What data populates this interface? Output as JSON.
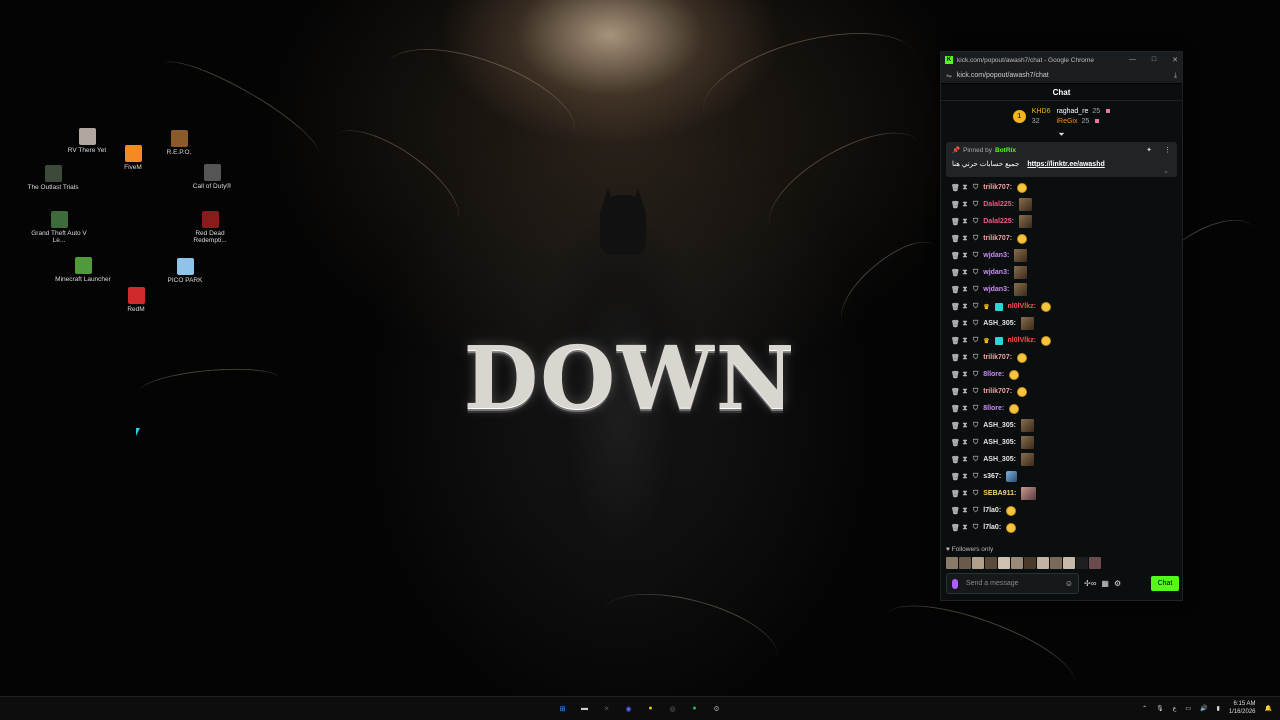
{
  "wallpaper": {
    "title": "DOWN"
  },
  "desktop": {
    "icons": [
      {
        "label": "RV There Yet",
        "icon": "rv-game-icon",
        "color": "#b0a7a0"
      },
      {
        "label": "R.E.P.O.",
        "icon": "repo-game-icon",
        "color": "#8a5a2b"
      },
      {
        "label": "The Outlast Trials",
        "icon": "outlast-icon",
        "color": "#3c4a3a"
      },
      {
        "label": "FiveM",
        "icon": "fivem-icon",
        "color": "#f28b22"
      },
      {
        "label": "Call of Duty®",
        "icon": "cod-icon",
        "color": "#555555"
      },
      {
        "label": "Grand Theft Auto V Le...",
        "icon": "gta-icon",
        "color": "#3e6b3a"
      },
      {
        "label": "Red Dead Redempti...",
        "icon": "rdr-icon",
        "color": "#8b1a1a"
      },
      {
        "label": "Minecraft Launcher",
        "icon": "minecraft-icon",
        "color": "#4f9a3a"
      },
      {
        "label": "PICO PARK",
        "icon": "picopark-icon",
        "color": "#8fc4e8"
      },
      {
        "label": "RedM",
        "icon": "redm-icon",
        "color": "#d02a2a"
      }
    ]
  },
  "browser": {
    "title": "kick.com/popout/awash7/chat - Google Chrome",
    "url": "kick.com/popout/awash7/chat",
    "controls": {
      "minimize": "—",
      "maximize": "□",
      "close": "✕"
    }
  },
  "chat": {
    "header": "Chat",
    "leaderboard": {
      "rank": "1",
      "entries": [
        {
          "name": "KHD6",
          "count": "32",
          "color": "#f2b617"
        },
        {
          "name": "raghad_re",
          "count": "25",
          "color": "#ffffff"
        },
        {
          "name": "iReGix",
          "count": "25",
          "color": "#f08a1f"
        }
      ]
    },
    "pinned": {
      "prefix": "Pinned by",
      "pinned_by": "BotRix",
      "text": "جميع حسابات حرتي هنا",
      "link": "https://linktr.ee/awashd"
    },
    "messages": [
      {
        "user": "trilik707:",
        "color": "#f2a1a1",
        "emote": "round"
      },
      {
        "user": "Dalal225:",
        "color": "#f05a8a",
        "emote": "pic"
      },
      {
        "user": "Dalal225:",
        "color": "#f05a8a",
        "emote": "pic"
      },
      {
        "user": "trilik707:",
        "color": "#f2a1a1",
        "emote": "round"
      },
      {
        "user": "wjdan3:",
        "color": "#c78cf2",
        "emote": "pic"
      },
      {
        "user": "wjdan3:",
        "color": "#c78cf2",
        "emote": "pic"
      },
      {
        "user": "wjdan3:",
        "color": "#c78cf2",
        "emote": "pic"
      },
      {
        "user": "nl0lVlkz:",
        "color": "#ff4b4b",
        "emote": "round",
        "badges": "crown-vip"
      },
      {
        "user": "ASH_305:",
        "color": "#e8e8e8",
        "emote": "pic"
      },
      {
        "user": "nl0lVlkz:",
        "color": "#ff4b4b",
        "emote": "round",
        "badges": "crown-vip"
      },
      {
        "user": "trilik707:",
        "color": "#f2a1a1",
        "emote": "round"
      },
      {
        "user": "8llore:",
        "color": "#c78cf2",
        "emote": "round"
      },
      {
        "user": "trilik707:",
        "color": "#f2a1a1",
        "emote": "round"
      },
      {
        "user": "8llore:",
        "color": "#c78cf2",
        "emote": "round"
      },
      {
        "user": "ASH_305:",
        "color": "#e8e8e8",
        "emote": "pic"
      },
      {
        "user": "ASH_305:",
        "color": "#e8e8e8",
        "emote": "pic"
      },
      {
        "user": "ASH_305:",
        "color": "#e8e8e8",
        "emote": "pic"
      },
      {
        "user": "s367:",
        "color": "#e8e8e8",
        "emote": "blue"
      },
      {
        "user": "SEBA911:",
        "color": "#f2d36b",
        "emote": "pic2"
      },
      {
        "user": "l7la0:",
        "color": "#e8e8e8",
        "emote": "round"
      },
      {
        "user": "l7la0:",
        "color": "#e8e8e8",
        "emote": "round"
      }
    ],
    "followers_only": "Followers only",
    "input_placeholder": "Send a message",
    "send_label": "Chat"
  },
  "taskbar": {
    "apps": [
      {
        "name": "start",
        "glyph": "⊞",
        "color": "#3aa0ff"
      },
      {
        "name": "file-explorer",
        "glyph": "▬",
        "color": "#cfcfcf"
      },
      {
        "name": "xbox",
        "glyph": "✕",
        "color": "#5c5c5c"
      },
      {
        "name": "discord",
        "glyph": "◉",
        "color": "#5865f2"
      },
      {
        "name": "chrome",
        "glyph": "●",
        "color": "#e0c21e"
      },
      {
        "name": "steam",
        "glyph": "◎",
        "color": "#777777"
      },
      {
        "name": "spotify",
        "glyph": "●",
        "color": "#1db954"
      },
      {
        "name": "settings",
        "glyph": "⚙",
        "color": "#9aa0a6"
      }
    ],
    "lang": "ع",
    "time": "6:15 AM",
    "date": "1/16/2026"
  }
}
